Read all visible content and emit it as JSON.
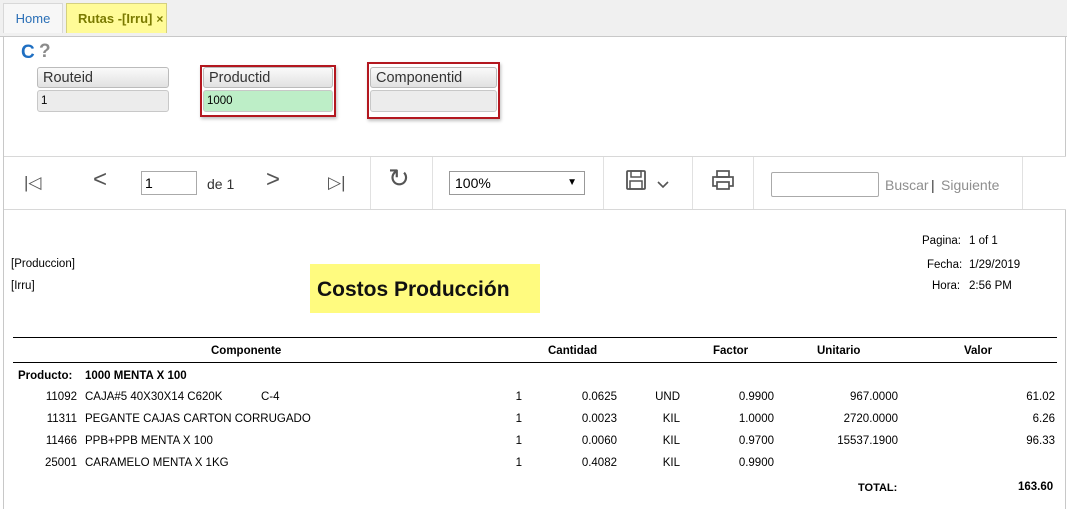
{
  "tabs": [
    {
      "label": "Home"
    },
    {
      "label": "Rutas -[Irru]",
      "close": "×"
    }
  ],
  "params": {
    "icons": [
      "refresh-icon",
      "help-icon"
    ],
    "refresh_glyph": "C",
    "help_glyph": "?",
    "routeid": {
      "label": "Routeid",
      "value": "1"
    },
    "productid": {
      "label": "Productid",
      "value": "1000"
    },
    "componentid": {
      "label": "Componentid",
      "value": ""
    }
  },
  "toolbar": {
    "first_glyph": "|◁",
    "prev_glyph": "<",
    "next_glyph": ">",
    "last_glyph": "▷|",
    "refresh_glyph": "↻",
    "save_glyph": "💾",
    "save_dropdown_glyph": "⌄",
    "print_glyph": "🖶",
    "page_value": "1",
    "page_of": "de 1",
    "zoom": "100%",
    "zoom_arrow": "▼",
    "search_value": "",
    "find_label": "Buscar",
    "separator": "|",
    "next_label": "Siguiente"
  },
  "report": {
    "header_left": [
      "[Produccion]",
      "[Irru]"
    ],
    "title": "Costos Producción",
    "meta": [
      {
        "label": "Pagina:",
        "value": "1 of 1"
      },
      {
        "label": "Fecha:",
        "value": "1/29/2019"
      },
      {
        "label": "Hora:",
        "value": "2:56 PM"
      }
    ],
    "columns": [
      "Componente",
      "Cantidad",
      "Factor",
      "Unitario",
      "Valor"
    ],
    "product_label": "Producto:",
    "product_value": "1000 MENTA X 100",
    "rows": [
      {
        "code": "11092",
        "desc": "CAJA#5 40X30X14 C620K",
        "extra": "C-4",
        "qty1": "1",
        "qty": "0.0625",
        "unit": "UND",
        "factor": "0.9900",
        "unitario": "967.0000",
        "valor": "61.02"
      },
      {
        "code": "11311",
        "desc": "PEGANTE CAJAS CARTON CORRUGADO",
        "extra": "",
        "qty1": "1",
        "qty": "0.0023",
        "unit": "KIL",
        "factor": "1.0000",
        "unitario": "2720.0000",
        "valor": "6.26"
      },
      {
        "code": "11466",
        "desc": "PPB+PPB MENTA X 100",
        "extra": "",
        "qty1": "1",
        "qty": "0.0060",
        "unit": "KIL",
        "factor": "0.9700",
        "unitario": "15537.1900",
        "valor": "96.33"
      },
      {
        "code": "25001",
        "desc": "CARAMELO MENTA X 1KG",
        "extra": "",
        "qty1": "1",
        "qty": "0.4082",
        "unit": "KIL",
        "factor": "0.9900",
        "unitario": "",
        "valor": ""
      }
    ],
    "total_label": "TOTAL:",
    "total_value": "163.60"
  },
  "colors": {
    "accent": "#1f6fc2",
    "tab_active": "#fffb97",
    "title_bg": "#fffb7f",
    "highlight_border": "#b3171f",
    "green_value": "#bdeec7"
  }
}
